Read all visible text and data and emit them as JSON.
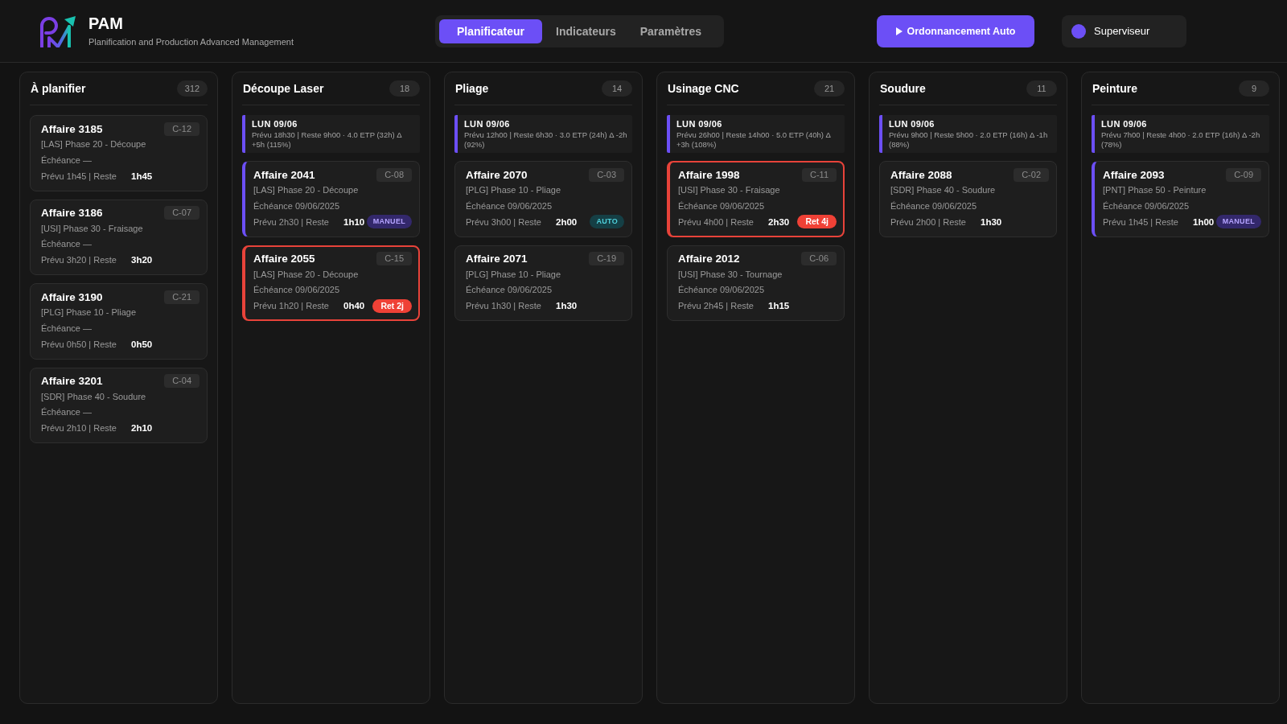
{
  "app": {
    "title": "PAM",
    "subtitle": "Planification and Production Advanced Management"
  },
  "tabs": [
    {
      "label": "Planificateur",
      "selected": true
    },
    {
      "label": "Indicateurs",
      "selected": false
    },
    {
      "label": "Paramètres",
      "selected": false
    }
  ],
  "auto_schedule_button": "Ordonnancement Auto",
  "user": {
    "name": "Superviseur"
  },
  "columns": [
    {
      "title": "À planifier",
      "count": "312",
      "cards": [
        {
          "title": "Affaire 3185",
          "code": "C-12",
          "phase": "[LAS] Phase 20 - Découpe",
          "due": "Échéance —",
          "planned": "Prévu 1h45 | Reste",
          "remaining": "1h45",
          "late": false,
          "accent_bar": false
        },
        {
          "title": "Affaire 3186",
          "code": "C-07",
          "phase": "[USI] Phase 30 - Fraisage",
          "due": "Échéance —",
          "planned": "Prévu 3h20 | Reste",
          "remaining": "3h20",
          "late": false,
          "accent_bar": false
        },
        {
          "title": "Affaire 3190",
          "code": "C-21",
          "phase": "[PLG] Phase 10 - Pliage",
          "due": "Échéance —",
          "planned": "Prévu 0h50 | Reste",
          "remaining": "0h50",
          "late": false,
          "accent_bar": false
        },
        {
          "title": "Affaire 3201",
          "code": "C-04",
          "phase": "[SDR] Phase 40 - Soudure",
          "due": "Échéance —",
          "planned": "Prévu 2h10 | Reste",
          "remaining": "2h10",
          "late": false,
          "accent_bar": false
        }
      ]
    },
    {
      "title": "Découpe Laser",
      "count": "18",
      "day": {
        "label": "LUN 09/06",
        "summary": "Prévu 18h30 | Reste 9h00 · 4.0 ETP (32h) Δ +5h (115%)"
      },
      "cards": [
        {
          "title": "Affaire 2041",
          "code": "C-08",
          "phase": "[LAS] Phase 20 - Découpe",
          "due": "Échéance 09/06/2025",
          "planned": "Prévu 2h30 | Reste",
          "remaining": "1h10",
          "badge": {
            "kind": "manual",
            "text": "MANUEL"
          },
          "late": false,
          "accent_bar": true
        },
        {
          "title": "Affaire 2055",
          "code": "C-15",
          "phase": "[LAS] Phase 20 - Découpe",
          "due": "Échéance 09/06/2025",
          "planned": "Prévu 1h20 | Reste",
          "remaining": "0h40",
          "badge": {
            "kind": "late",
            "text": "Ret 2j"
          },
          "late": true,
          "accent_bar": true
        }
      ]
    },
    {
      "title": "Pliage",
      "count": "14",
      "day": {
        "label": "LUN 09/06",
        "summary": "Prévu 12h00 | Reste 6h30 · 3.0 ETP (24h) Δ -2h (92%)"
      },
      "cards": [
        {
          "title": "Affaire 2070",
          "code": "C-03",
          "phase": "[PLG] Phase 10 - Pliage",
          "due": "Échéance 09/06/2025",
          "planned": "Prévu 3h00 | Reste",
          "remaining": "2h00",
          "badge": {
            "kind": "auto",
            "text": "AUTO"
          },
          "late": false,
          "accent_bar": false
        },
        {
          "title": "Affaire 2071",
          "code": "C-19",
          "phase": "[PLG] Phase 10 - Pliage",
          "due": "Échéance 09/06/2025",
          "planned": "Prévu 1h30 | Reste",
          "remaining": "1h30",
          "late": false,
          "accent_bar": false
        }
      ]
    },
    {
      "title": "Usinage CNC",
      "count": "21",
      "day": {
        "label": "LUN 09/06",
        "summary": "Prévu 26h00 | Reste 14h00 · 5.0 ETP (40h) Δ +3h (108%)"
      },
      "cards": [
        {
          "title": "Affaire 1998",
          "code": "C-11",
          "phase": "[USI] Phase 30 - Fraisage",
          "due": "Échéance 09/06/2025",
          "planned": "Prévu 4h00 | Reste",
          "remaining": "2h30",
          "badge": {
            "kind": "late",
            "text": "Ret 4j"
          },
          "late": true,
          "accent_bar": true
        },
        {
          "title": "Affaire 2012",
          "code": "C-06",
          "phase": "[USI] Phase 30 - Tournage",
          "due": "Échéance 09/06/2025",
          "planned": "Prévu 2h45 | Reste",
          "remaining": "1h15",
          "late": false,
          "accent_bar": false
        }
      ]
    },
    {
      "title": "Soudure",
      "count": "11",
      "day": {
        "label": "LUN 09/06",
        "summary": "Prévu 9h00 | Reste 5h00 · 2.0 ETP (16h) Δ -1h (88%)"
      },
      "cards": [
        {
          "title": "Affaire 2088",
          "code": "C-02",
          "phase": "[SDR] Phase 40 - Soudure",
          "due": "Échéance 09/06/2025",
          "planned": "Prévu 2h00 | Reste",
          "remaining": "1h30",
          "late": false,
          "accent_bar": false
        }
      ]
    },
    {
      "title": "Peinture",
      "count": "9",
      "day": {
        "label": "LUN 09/06",
        "summary": "Prévu 7h00 | Reste 4h00 · 2.0 ETP (16h) Δ -2h (78%)"
      },
      "cards": [
        {
          "title": "Affaire 2093",
          "code": "C-09",
          "phase": "[PNT] Phase 50 - Peinture",
          "due": "Échéance 09/06/2025",
          "planned": "Prévu 1h45 | Reste",
          "remaining": "1h00",
          "badge": {
            "kind": "manual",
            "text": "MANUEL"
          },
          "late": false,
          "accent_bar": true
        }
      ]
    }
  ]
}
